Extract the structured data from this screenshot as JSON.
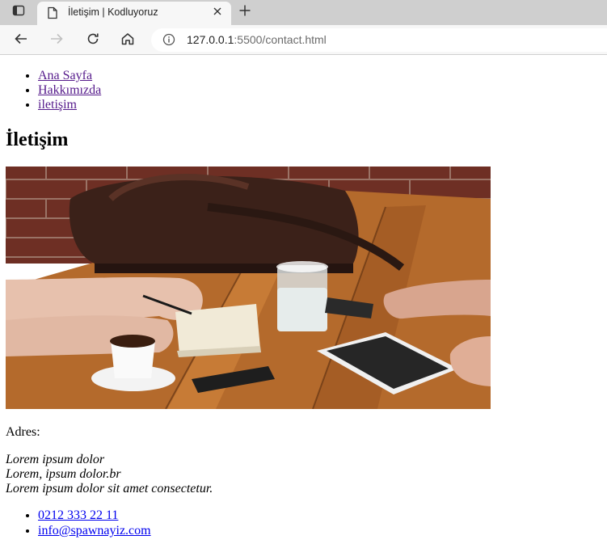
{
  "browser": {
    "tab_title": "İletişim | Kodluyoruz",
    "url_host": "127.0.0.1",
    "url_rest": ":5500/contact.html"
  },
  "nav": {
    "items": [
      {
        "label": "Ana Sayfa"
      },
      {
        "label": "Hakkımızda"
      },
      {
        "label": "iletişim"
      }
    ]
  },
  "page": {
    "heading": "İletişim",
    "address_label": "Adres:",
    "address_lines": [
      "Lorem ipsum dolor",
      "Lorem, ipsum dolor.br",
      "Lorem ipsum dolor sit amet consectetur."
    ]
  },
  "contact": {
    "phone": "0212 333 22 11",
    "email": "info@spawnayiz.com"
  },
  "colors": {
    "tabstrip": "#cfcfcf",
    "toolbar": "#f7f7f7",
    "link_visited": "#551a8b",
    "link_unvisited": "#0000ee"
  }
}
